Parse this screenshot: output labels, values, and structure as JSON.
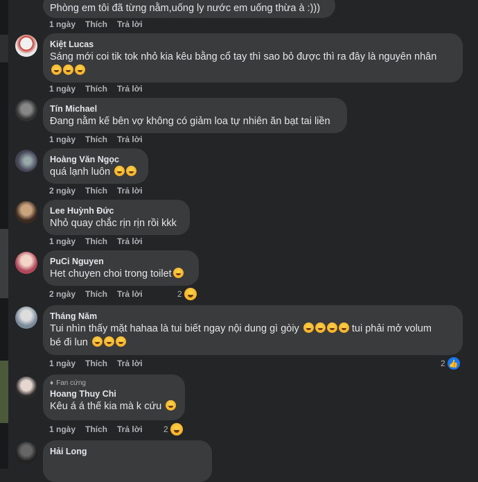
{
  "comments": [
    {
      "name": "",
      "text": "Phòng em tôi đã từng nằm,uống ly nước em uống thừa à :)))",
      "time": "1 ngày"
    },
    {
      "name": "Kiệt Lucas",
      "text": "Sáng mới coi tik tok nhỏ kia kêu bằng cổ tay thì sao bỏ được thì ra đây là nguyên nhân",
      "time": "1 ngày"
    },
    {
      "name": "Tín Michael",
      "text": "Đang nằm kế bên vợ không có giảm loa tự nhiên ăn bạt tai liền",
      "time": "1 ngày"
    },
    {
      "name": "Hoàng Văn Ngọc",
      "text": "quá lạnh luôn",
      "time": "2 ngày"
    },
    {
      "name": "Lee Huỳnh Đức",
      "text": "Nhỏ quay chắc rịn rịn rồi kkk",
      "time": "1 ngày"
    },
    {
      "name": "PuCi Nguyen",
      "text": "Het chuyen choi trong toilet",
      "time": "2 ngày",
      "reactions": "2"
    },
    {
      "name": "Tháng Năm",
      "text": "Tui nhìn thấy mặt hahaa là tui biết ngay nội dung gì gòiy",
      "text_after": "tui phải mở volum",
      "text2": "bé đi lun",
      "time": "1 ngày",
      "reactions": "2"
    },
    {
      "badge": "Fan cứng",
      "name": "Hoang Thuy Chi",
      "text": "Kêu á á thế kia mà k cứu",
      "time": "1 ngày",
      "reactions": "2"
    },
    {
      "name": "Hải Long"
    }
  ],
  "actions": {
    "like": "Thích",
    "reply": "Trả lời"
  },
  "colors": {
    "background": "#242526",
    "bubble": "#3a3b3c",
    "secondary_text": "#b0b3b8",
    "like_blue": "#1877f2"
  },
  "icons": {
    "laugh": "rolling-on-floor-laughing-emoji",
    "grin": "grinning-emoji",
    "like": "like-icon",
    "haha": "haha-icon",
    "fan": "diamond-icon"
  }
}
